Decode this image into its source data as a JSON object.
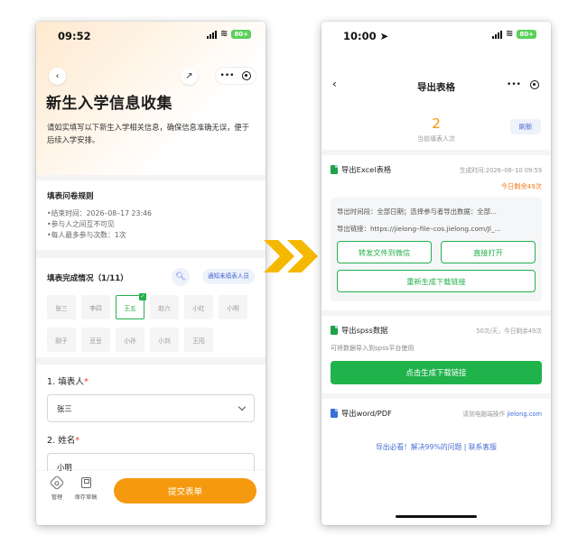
{
  "left": {
    "status": {
      "time": "09:52",
      "battery": "80+"
    },
    "title": "新生入学信息收集",
    "intro": "请如实填写以下新生入学相关信息，确保信息准确无误，便于后续入学安排。",
    "rules": {
      "heading": "填表问卷规则",
      "items": [
        "•结束时间：2026–08–17 23:46",
        "•参与人之间互不可见",
        "•每人最多参与次数：1次"
      ]
    },
    "completion": {
      "heading": "填表完成情况（1/11）",
      "notify_label": "通知未填表人员",
      "names": [
        "张三",
        "李四",
        "王五",
        "赵六",
        "小红",
        "小明",
        "刚子",
        "豆豆",
        "小孙",
        "小刘",
        "王阳"
      ],
      "active_index": 2
    },
    "questions": [
      {
        "label": "1. 填表人",
        "value": "张三"
      },
      {
        "label": "2. 姓名",
        "value": "小明"
      }
    ],
    "bottom": {
      "manage_label": "管理",
      "draft_label": "保存草稿",
      "submit_label": "提交表单"
    }
  },
  "right": {
    "status": {
      "time": "10:00",
      "battery": "80+"
    },
    "title": "导出表格",
    "count": "2",
    "count_label": "当前填表人次",
    "refresh_label": "刷新",
    "excel": {
      "title": "导出Excel表格",
      "meta": "生成时间:2026–08–10 09:59",
      "remaining": "今日剩余49次",
      "period": "导出时间段：全部日期；选择参与者导出数据：全部...",
      "link": "导出链接：https://jielong–file–cos.jielong.com/Jl_...",
      "forward_label": "转发文件到微信",
      "open_label": "直接打开",
      "regenerate_label": "重新生成下载链接"
    },
    "spss": {
      "title": "导出spss数据",
      "meta": "50次/天，今日剩余49次",
      "desc": "可将数据导入到spss平台使用",
      "button_label": "点击生成下载链接"
    },
    "word": {
      "title": "导出word/PDF",
      "meta_prefix": "请到电脑端操作 ",
      "meta_link": "jielong.com"
    },
    "help_text": "导出必看！解决99%的问题  |  联系客服"
  },
  "colors": {
    "accent_orange": "#f59a0e",
    "accent_green": "#20b34c",
    "accent_blue": "#4a6fd6",
    "arrow_yellow": "#f5b800"
  }
}
